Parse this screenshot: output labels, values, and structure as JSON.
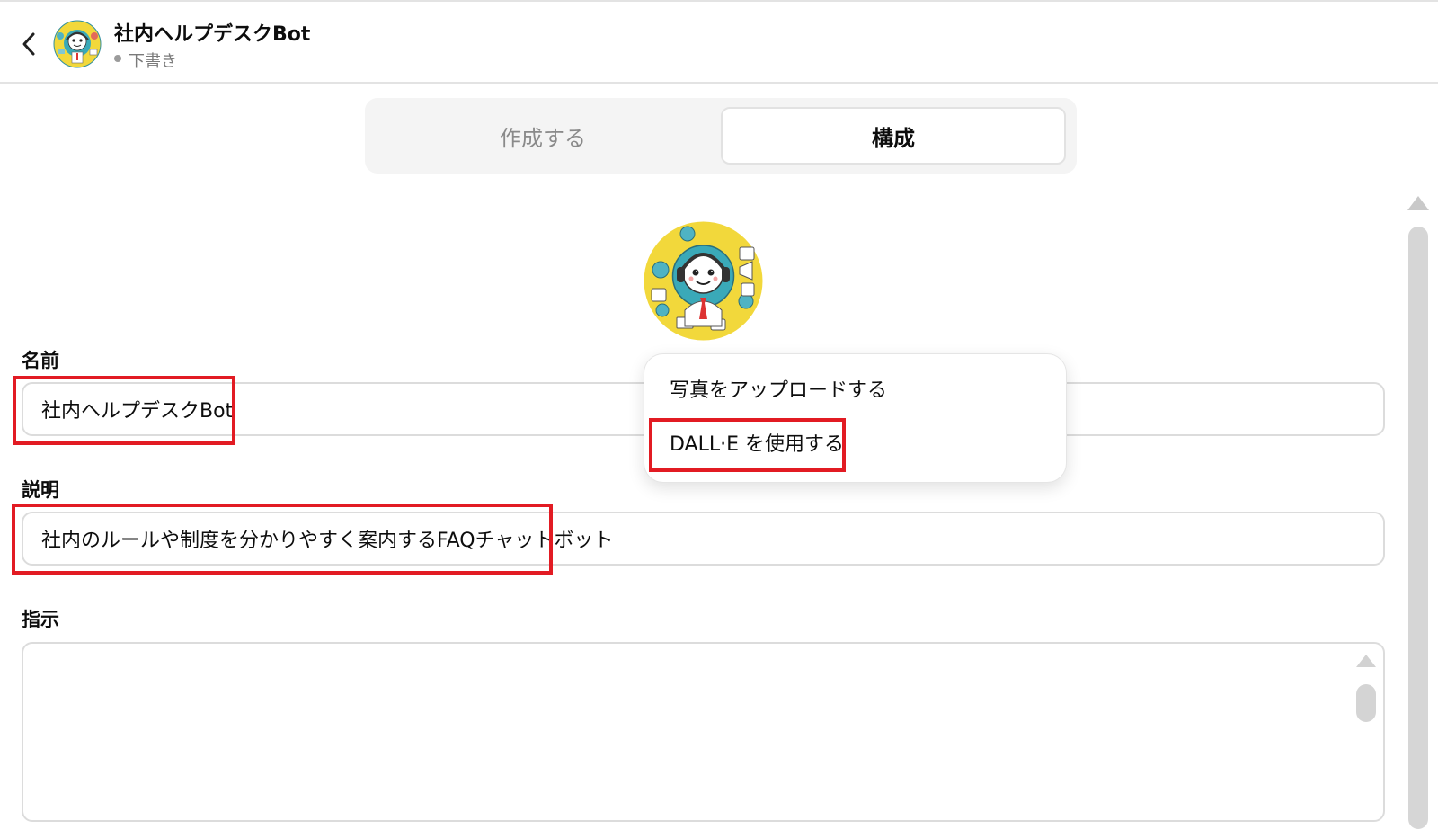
{
  "header": {
    "title": "社内ヘルプデスクBot",
    "status": "下書き"
  },
  "tabs": [
    {
      "label": "作成する",
      "active": false
    },
    {
      "label": "構成",
      "active": true
    }
  ],
  "form": {
    "name_label": "名前",
    "name_value": "社内ヘルプデスクBot",
    "description_label": "説明",
    "description_value": "社内のルールや制度を分かりやすく案内するFAQチャットボット",
    "instructions_label": "指示",
    "instructions_value": ""
  },
  "avatar_menu": {
    "items": [
      {
        "label": "写真をアップロードする"
      },
      {
        "label": "DALL·E を使用する"
      }
    ]
  },
  "colors": {
    "highlight": "#e21b23",
    "avatar_bg": "#f2d83b",
    "avatar_ring": "#3aa9b8"
  },
  "icons": {
    "back": "chevron-left-icon",
    "status": "status-dot-icon"
  }
}
